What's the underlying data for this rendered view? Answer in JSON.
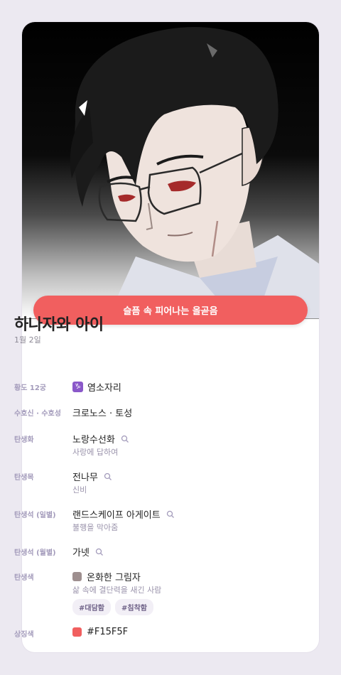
{
  "banner": {
    "text": "슬픔 속 피어나는 올곧음"
  },
  "header": {
    "title": "하나자와 아이",
    "date": "1월 2일"
  },
  "zodiac": {
    "label": "황도 12궁",
    "icon_symbol": "♑",
    "icon_name": "capricorn-icon",
    "value": "염소자리"
  },
  "guardian": {
    "label": "수호신 · 수호성",
    "value": "크로노스 · 토성"
  },
  "birth_flower": {
    "label": "탄생화",
    "value": "노랑수선화",
    "meaning": "사랑에 답하여"
  },
  "birth_tree": {
    "label": "탄생목",
    "value": "전나무",
    "meaning": "신비"
  },
  "birth_stone_daily": {
    "label": "탄생석 (일별)",
    "value": "랜드스케이프 아게이트",
    "meaning": "불행을 막아줌"
  },
  "birth_stone_monthly": {
    "label": "탄생석 (월별)",
    "value": "가넷"
  },
  "birth_color": {
    "label": "탄생색",
    "value": "온화한 그림자",
    "meaning": "삶 속에 결단력을 새긴 사람",
    "swatch_color": "#9e8f8f",
    "tags": [
      "#대담함",
      "#침착함"
    ]
  },
  "symbol_color": {
    "label": "상징색",
    "value": "#F15F5F",
    "swatch_color": "#f15f5f"
  },
  "colors": {
    "accent": "#f15f5f",
    "label": "#a39bbb",
    "background": "#ece9f1"
  }
}
